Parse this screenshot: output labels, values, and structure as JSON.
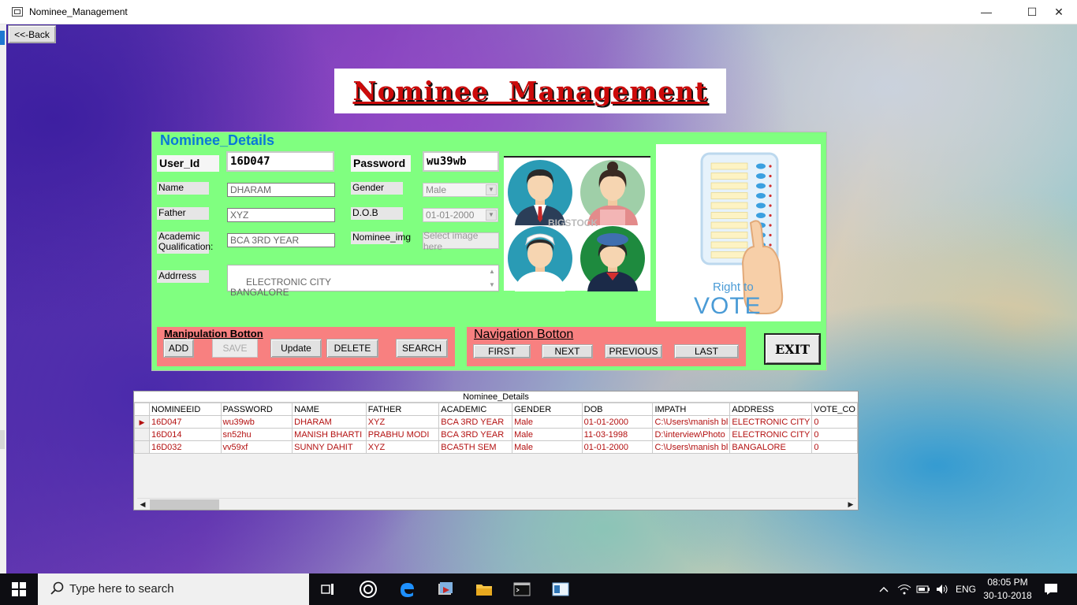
{
  "window": {
    "title": "Nominee_Management",
    "minimize": "—",
    "maximize": "☐",
    "close": "✕"
  },
  "back_button": "<<-Back",
  "banner_title": "Nominee  Management",
  "details": {
    "group_title": "Nominee_Details",
    "user_id_label": "User_Id",
    "user_id_value": "16D047",
    "password_label": "Password",
    "password_value": "wu39wb",
    "name_label": "Name",
    "name_value": "DHARAM",
    "gender_label": "Gender",
    "gender_value": "Male",
    "father_label": "Father",
    "father_value": "XYZ",
    "dob_label": "D.O.B",
    "dob_value": "01-01-2000",
    "academic_label": "Academic Qualification:",
    "academic_value": "BCA 3RD YEAR",
    "nominee_img_label": "Nominee_img",
    "select_image_button": "Select image here",
    "address_label": "Addrress",
    "address_value": "ELECTRONIC CITY\nBANGALORE",
    "watermark": "BIGSTOCK",
    "vote_poster": {
      "line1": "Right to",
      "line2": "VOTE"
    }
  },
  "manipulation": {
    "title": "Manipulation Botton",
    "buttons": [
      "ADD",
      "SAVE",
      "Update",
      "DELETE",
      "SEARCH"
    ]
  },
  "navigation": {
    "title": "Navigation Botton",
    "buttons": [
      "FIRST",
      "NEXT",
      "PREVIOUS",
      "LAST"
    ]
  },
  "exit_button": "EXIT",
  "grid": {
    "caption": "Nominee_Details",
    "columns": [
      "NOMINEEID",
      "PASSWORD",
      "NAME",
      "FATHER",
      "ACADEMIC",
      "GENDER",
      "DOB",
      "IMPATH",
      "ADDRESS",
      "VOTE_CO"
    ],
    "rows": [
      [
        "16D047",
        "wu39wb",
        "DHARAM",
        "XYZ",
        "BCA 3RD YEAR",
        "Male",
        "01-01-2000",
        "C:\\Users\\manish bl",
        "ELECTRONIC CITY",
        "0"
      ],
      [
        "16D014",
        "sn52hu",
        "MANISH BHARTI",
        "PRABHU MODI",
        "BCA 3RD YEAR",
        "Male",
        "11-03-1998",
        "D:\\interview\\Photo",
        "ELECTRONIC CITY",
        "0"
      ],
      [
        "16D032",
        "vv59xf",
        "SUNNY DAHIT",
        "XYZ",
        "BCA5TH SEM",
        "Male",
        "01-01-2000",
        "C:\\Users\\manish bl",
        "BANGALORE",
        "0"
      ]
    ],
    "current_row_indicator": "▶"
  },
  "taskbar": {
    "search_placeholder": "Type here to search",
    "language": "ENG",
    "time": "08:05 PM",
    "date": "30-10-2018"
  },
  "colors": {
    "form_green": "#80ff80",
    "panel_red": "#f88080",
    "title_red": "#cc0a0a",
    "group_title_blue": "#0a78d7",
    "grid_text": "#b31010"
  }
}
